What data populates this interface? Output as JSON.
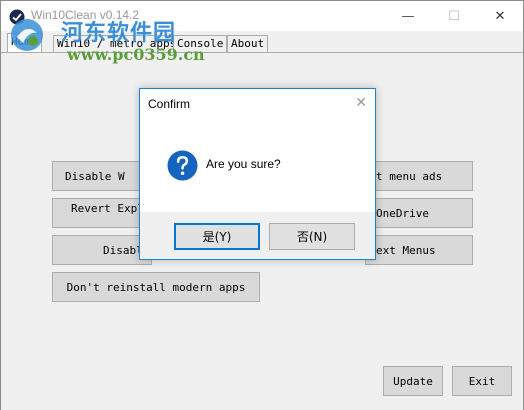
{
  "window": {
    "title": "Win10Clean v0.14.2",
    "controls": {
      "minimize": "—",
      "maximize": "☐",
      "close": "✕"
    }
  },
  "watermark": {
    "title": "河东软件园",
    "url": "www.pc0359.cn"
  },
  "tabs": [
    {
      "label": "Home",
      "active": true
    },
    {
      "label": "Win10 / metro apps",
      "active": false
    },
    {
      "label": "Console",
      "active": false
    },
    {
      "label": "About",
      "active": false
    }
  ],
  "buttons": {
    "disable_w": "Disable W",
    "revert_expl": "Revert Expl",
    "disabl": "Disabl",
    "dont_reinstall": "Don't reinstall modern apps",
    "start_menu_ads": "t menu ads",
    "onedrive": "OneDrive",
    "context_menus": "ext Menus",
    "update": "Update",
    "exit": "Exit"
  },
  "dialog": {
    "title": "Confirm",
    "close": "✕",
    "message": "Are you sure?",
    "yes": "是(Y)",
    "no": "否(N)",
    "icon": "question-icon"
  },
  "colors": {
    "accent": "#0078d7",
    "question_icon": "#1565c0",
    "watermark_blue": "#3a8fd8",
    "watermark_green": "#5a9e3b"
  }
}
